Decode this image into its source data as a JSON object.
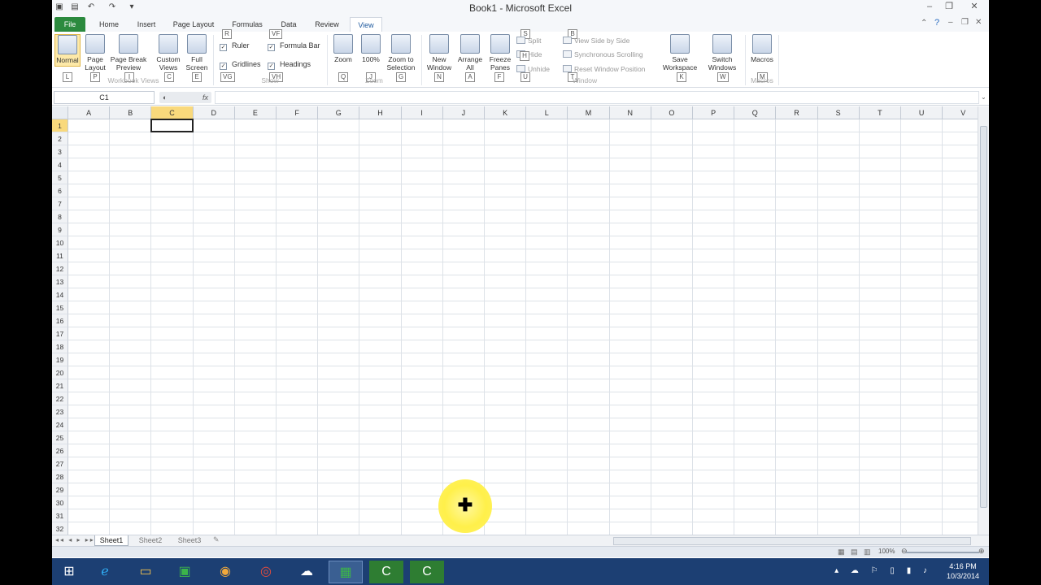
{
  "window": {
    "title": "Book1 - Microsoft Excel",
    "controls": {
      "minimize": "–",
      "restore": "❐",
      "close": "✕"
    }
  },
  "tabs": [
    "File",
    "Home",
    "Insert",
    "Page Layout",
    "Formulas",
    "Data",
    "Review",
    "View"
  ],
  "ribbon": {
    "workbook_views": {
      "label": "Workbook Views",
      "buttons": [
        {
          "label": "Normal",
          "key": "L"
        },
        {
          "label": "Page Layout",
          "key": "P"
        },
        {
          "label": "Page Break Preview",
          "key": "I"
        },
        {
          "label": "Custom Views",
          "key": "C"
        },
        {
          "label": "Full Screen",
          "key": "E"
        }
      ]
    },
    "show": {
      "label": "Show",
      "checks": [
        {
          "label": "Ruler",
          "key": "R"
        },
        {
          "label": "Formula Bar",
          "key": "VF"
        },
        {
          "label": "Gridlines",
          "key": "VG"
        },
        {
          "label": "Headings",
          "key": "VH"
        }
      ]
    },
    "zoom": {
      "label": "Zoom",
      "buttons": [
        {
          "label": "Zoom",
          "key": "Q"
        },
        {
          "label": "100%",
          "key": "J"
        },
        {
          "label": "Zoom to Selection",
          "key": "G"
        }
      ]
    },
    "window_group": {
      "label": "Window",
      "buttons": [
        {
          "label": "New Window",
          "key": "N"
        },
        {
          "label": "Arrange All",
          "key": "A"
        },
        {
          "label": "Freeze Panes",
          "key": "F"
        }
      ],
      "small": [
        {
          "label": "Split",
          "key": "S"
        },
        {
          "label": "Hide",
          "key": "H"
        },
        {
          "label": "Unhide",
          "key": "U"
        },
        {
          "label": "View Side by Side",
          "key": "B"
        },
        {
          "label": "Synchronous Scrolling",
          "key": ""
        },
        {
          "label": "Reset Window Position",
          "key": "T"
        }
      ],
      "switch": [
        {
          "label": "Save Workspace",
          "key": "K"
        },
        {
          "label": "Switch Windows",
          "key": "W"
        }
      ]
    },
    "macros": {
      "label": "Macros",
      "button": "Macros",
      "key": "M"
    }
  },
  "formula_bar": {
    "name_box": "C1",
    "fx": "fx",
    "value": ""
  },
  "columns": [
    "A",
    "B",
    "C",
    "D",
    "E",
    "F",
    "G",
    "H",
    "I",
    "J",
    "K",
    "L",
    "M",
    "N",
    "O",
    "P",
    "Q",
    "R",
    "S",
    "T",
    "U",
    "V"
  ],
  "rows": [
    "1",
    "2",
    "3",
    "4",
    "5",
    "6",
    "7",
    "8",
    "9",
    "10",
    "11",
    "12",
    "13",
    "14",
    "15",
    "16",
    "17",
    "18",
    "19",
    "20",
    "21",
    "22",
    "23",
    "24",
    "25",
    "26",
    "27",
    "28",
    "29",
    "30",
    "31",
    "32"
  ],
  "active_cell": "C1",
  "sheets": [
    "Sheet1",
    "Sheet2",
    "Sheet3"
  ],
  "active_sheet": "Sheet1",
  "status": {
    "zoom": "100%"
  },
  "taskbar": {
    "apps": [
      "start-icon",
      "ie-icon",
      "explorer-icon",
      "excel-icon",
      "outlook-icon",
      "chrome-icon",
      "onedrive-icon",
      "excel-window-icon",
      "camtasia-icon",
      "camtasia-recorder-icon"
    ],
    "time": "4:16 PM",
    "date": "10/3/2014"
  }
}
